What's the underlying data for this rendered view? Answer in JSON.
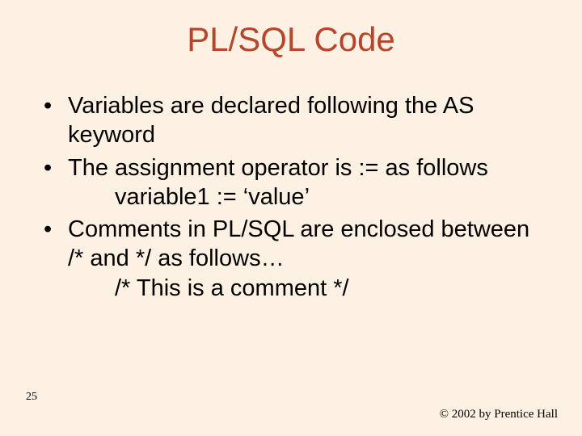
{
  "title": "PL/SQL Code",
  "bullets": [
    {
      "text": "Variables are declared following the AS keyword",
      "sub": null
    },
    {
      "text": "The assignment operator is := as follows",
      "sub": "variable1 := ‘value’"
    },
    {
      "text": "Comments in PL/SQL are enclosed between /* and */ as follows…",
      "sub": "/* This is a comment */"
    }
  ],
  "page_number": "25",
  "copyright": "© 2002 by Prentice Hall"
}
